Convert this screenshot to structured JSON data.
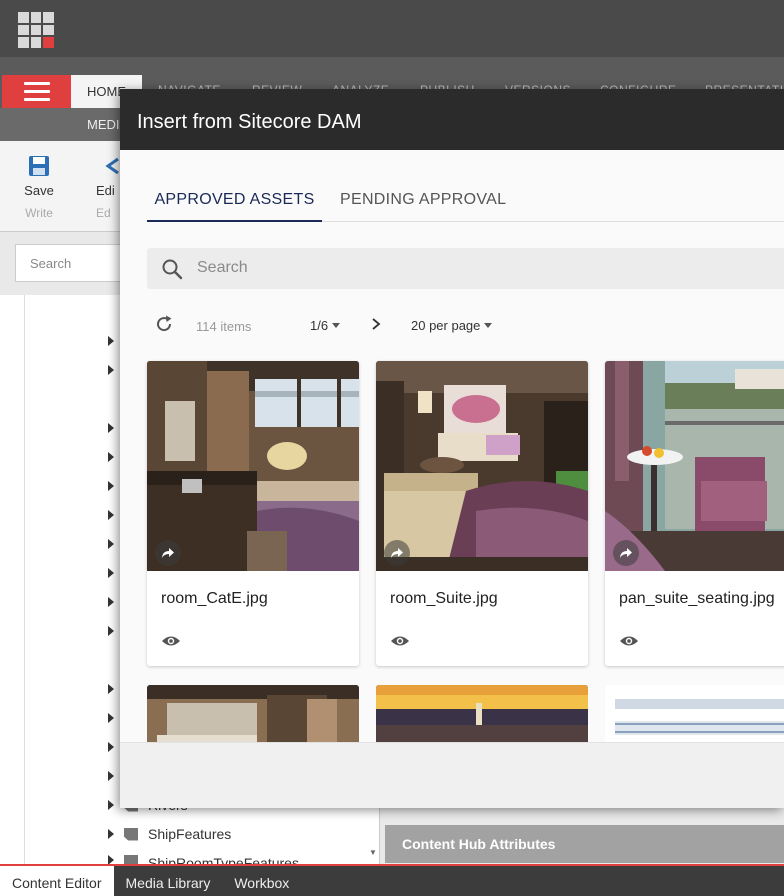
{
  "app": {
    "ribbon_tabs": [
      "HOME",
      "NAVIGATE",
      "REVIEW",
      "ANALYZE",
      "PUBLISH",
      "VERSIONS",
      "CONFIGURE",
      "PRESENTATION"
    ],
    "active_tab": "HOME",
    "sub_tab": "MEDI",
    "toolbar": {
      "save_label": "Save",
      "save_group": "Write",
      "edit_label": "Edi",
      "edit_group": "Ed"
    },
    "tree_search_placeholder": "Search",
    "tree_items": [
      "Rivers",
      "ShipFeatures",
      "ShipRoomTypeFeatures"
    ],
    "right_panel_title": "Content Hub Attributes",
    "bottom_tabs": [
      "Content Editor",
      "Media Library",
      "Workbox"
    ],
    "colors": {
      "accent_red": "#e03f3f",
      "dark_header": "#2b2b2b",
      "tab_active": "#1a2a56"
    }
  },
  "dialog": {
    "title": "Insert from Sitecore DAM",
    "tabs": [
      "APPROVED ASSETS",
      "PENDING APPROVAL"
    ],
    "search_placeholder": "Search",
    "item_count": "114 items",
    "page": "1/6",
    "per_page": "20 per page",
    "assets": [
      {
        "name": "room_CatE.jpg"
      },
      {
        "name": "room_Suite.jpg"
      },
      {
        "name": "pan_suite_seating.jpg"
      }
    ]
  }
}
